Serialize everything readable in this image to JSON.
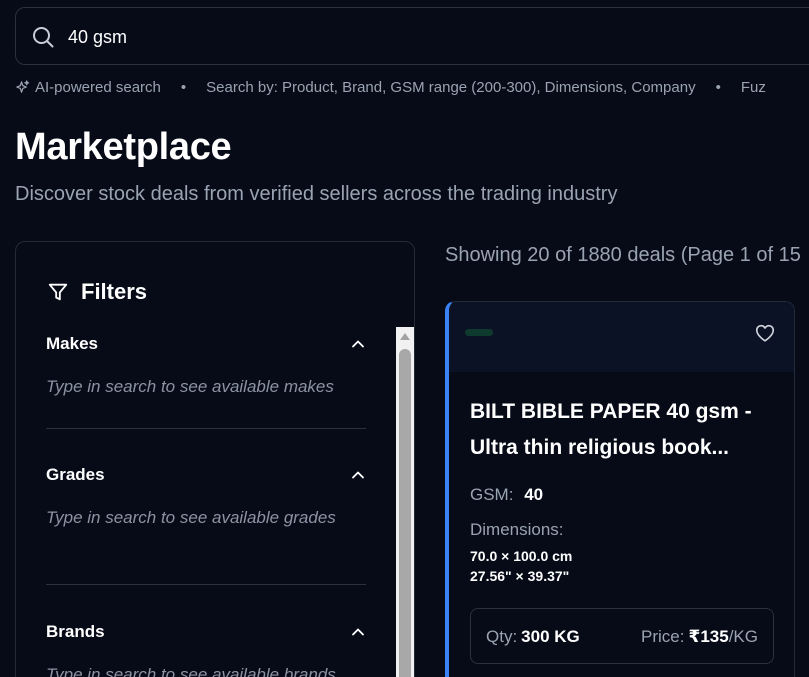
{
  "search": {
    "value": "40 gsm",
    "hints": [
      "AI-powered search",
      "Search by: Product, Brand, GSM range (200-300), Dimensions, Company",
      "Fuz"
    ]
  },
  "header": {
    "title": "Marketplace",
    "subtitle": "Discover stock deals from verified sellers across the trading industry"
  },
  "filters": {
    "title": "Filters",
    "sections": [
      {
        "name": "Makes",
        "hint": "Type in search to see available makes"
      },
      {
        "name": "Grades",
        "hint": "Type in search to see available grades"
      },
      {
        "name": "Brands",
        "hint": "Type in search to see available brands"
      }
    ]
  },
  "results": {
    "showing": "Showing 20 of 1880 deals (Page 1 of 15"
  },
  "deal": {
    "title": "BILT BIBLE PAPER 40 gsm - Ultra thin religious book...",
    "gsm_label": "GSM:",
    "gsm_value": "40",
    "dimensions_label": "Dimensions:",
    "dimensions_cm": "70.0 × 100.0 cm",
    "dimensions_in": "27.56\" × 39.37\"",
    "qty_label": "Qty:",
    "qty_value": "300 KG",
    "price_label": "Price:",
    "price_value": "₹135",
    "price_unit": "/KG"
  },
  "colors": {
    "background": "#070b18",
    "accent_border": "#3b82f6",
    "muted_text": "#9aa3b2"
  },
  "icons": [
    "search-icon",
    "sparkle-icon",
    "filter-icon",
    "chevron-up-icon",
    "heart-icon"
  ]
}
